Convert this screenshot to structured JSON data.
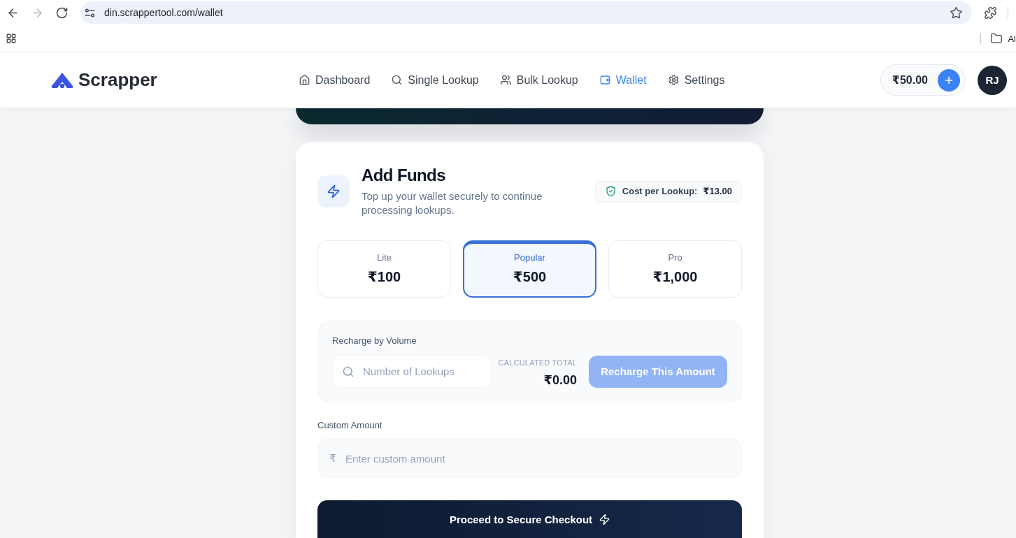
{
  "browser": {
    "nav_buttons": [
      {
        "kind": "back",
        "disabled": false
      },
      {
        "kind": "forward",
        "disabled": true
      },
      {
        "kind": "reload",
        "disabled": false
      }
    ],
    "url": "din.scrappertool.com/wallet",
    "bookmarks": [
      {
        "label": "Al"
      }
    ]
  },
  "app_bar": {
    "logo": "Scrapper",
    "nav": [
      {
        "label": "Dashboard",
        "selected": false
      },
      {
        "label": "Single Lookup",
        "selected": false
      },
      {
        "label": "Bulk Lookup",
        "selected": false
      },
      {
        "label": "Wallet",
        "selected": true
      },
      {
        "label": "Settings",
        "selected": false
      }
    ],
    "balance": "₹50.00",
    "avatar": "RJ"
  },
  "add_funds": {
    "title": "Add Funds",
    "subtitle": "Top up your wallet securely to continue processing lookups.",
    "cost_label": "Cost per Lookup:",
    "cost_value": "₹13.00",
    "plans": [
      {
        "name": "Lite",
        "amount": "₹100",
        "selected": false
      },
      {
        "name": "Popular",
        "amount": "₹500",
        "selected": true
      },
      {
        "name": "Pro",
        "amount": "₹1,000",
        "selected": false
      }
    ],
    "volume": {
      "label": "Recharge by Volume",
      "placeholder": "Number of Lookups",
      "total_label": "CALCULATED TOTAL",
      "total": "₹0.00",
      "button": {
        "label": "Recharge This Amount",
        "disabled": true
      }
    },
    "custom": {
      "label": "Custom Amount",
      "currency": "₹",
      "placeholder": "Enter custom amount"
    },
    "checkout": {
      "label": "Proceed to Secure Checkout"
    }
  }
}
